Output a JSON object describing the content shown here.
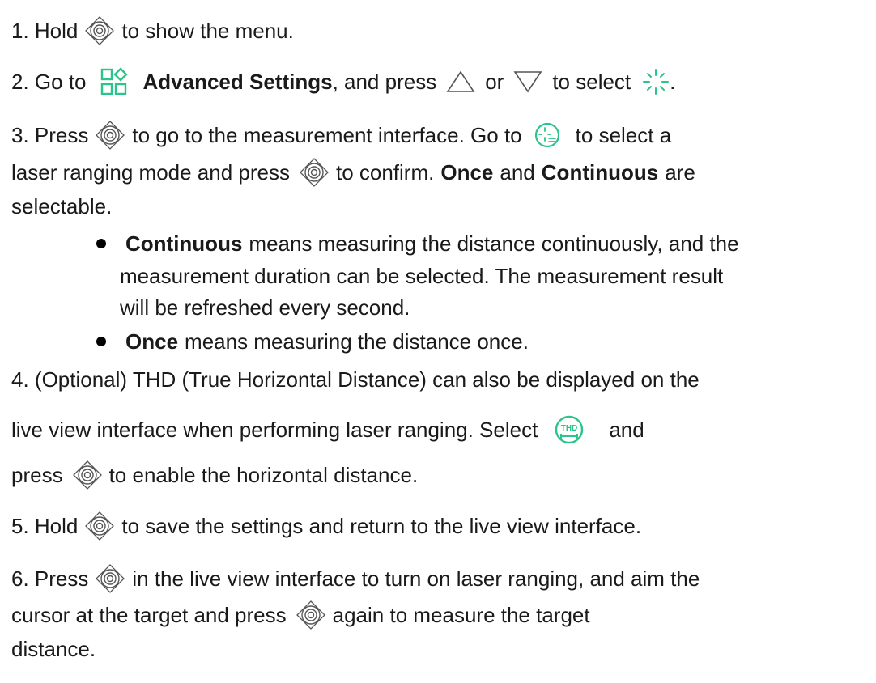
{
  "colors": {
    "text": "#1a1a1a",
    "accent": "#2bc48a",
    "icon_gray": "#555555"
  },
  "icons": {
    "joystick": "joystick-icon",
    "advanced_settings": "advanced-settings-icon",
    "up": "up-triangle-icon",
    "down": "down-triangle-icon",
    "laser_ranging": "laser-ranging-icon",
    "laser_mode": "laser-mode-icon",
    "thd": "thd-icon"
  },
  "thd_icon_text": "THD",
  "steps": {
    "s1": {
      "a": "1. Hold",
      "b": "to show the menu."
    },
    "s2": {
      "a": "2. Go to",
      "bold": "Advanced Settings",
      "b": ", and press",
      "c": "or",
      "d": "to select",
      "e": "."
    },
    "s3": {
      "a": "3. Press",
      "b": "to go to the measurement interface. Go to",
      "c": "to select a",
      "d": "laser ranging mode and press",
      "e": "to confirm.",
      "once": "Once",
      "and": "and",
      "continuous": "Continuous",
      "f": "are",
      "g": "selectable."
    },
    "bullet1": {
      "bold": "Continuous",
      "a": "means measuring the distance continuously, and the",
      "b": "measurement duration can be selected. The measurement result",
      "c": "will be refreshed every second."
    },
    "bullet2": {
      "bold": "Once",
      "a": "means measuring the distance once."
    },
    "s4": {
      "a": "4. (Optional) THD (True Horizontal Distance) can also be displayed on the",
      "b": "live view interface when performing laser ranging. Select",
      "c": "and",
      "d": "press",
      "e": "to enable the horizontal distance."
    },
    "s5": {
      "a": "5. Hold",
      "b": "to save the settings and return to the live view interface."
    },
    "s6": {
      "a": "6. Press",
      "b": "in the live view interface to turn on laser ranging, and aim the",
      "c": "cursor at the target and press",
      "d": "again to measure the target",
      "e": "distance."
    }
  }
}
